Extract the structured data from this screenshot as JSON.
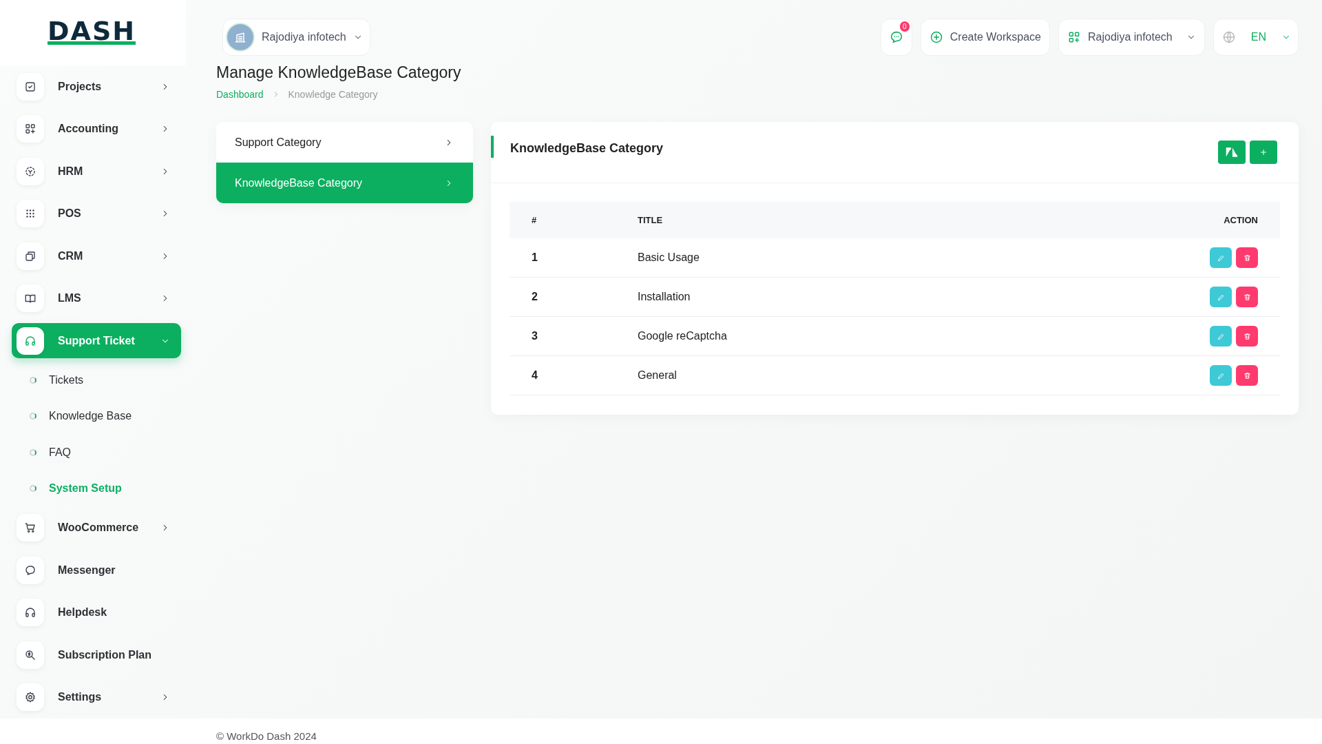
{
  "logo": "DASH",
  "sidebar": {
    "items": [
      {
        "label": "Projects",
        "has_submenu": true,
        "expanded": false,
        "selected": false
      },
      {
        "label": "Accounting",
        "has_submenu": true,
        "expanded": false,
        "selected": false
      },
      {
        "label": "HRM",
        "has_submenu": true,
        "expanded": false,
        "selected": false
      },
      {
        "label": "POS",
        "has_submenu": true,
        "expanded": false,
        "selected": false
      },
      {
        "label": "CRM",
        "has_submenu": true,
        "expanded": false,
        "selected": false
      },
      {
        "label": "LMS",
        "has_submenu": true,
        "expanded": false,
        "selected": false
      },
      {
        "label": "Support Ticket",
        "has_submenu": true,
        "expanded": true,
        "selected": true,
        "children": [
          {
            "label": "Tickets",
            "selected": false
          },
          {
            "label": "Knowledge Base",
            "selected": false
          },
          {
            "label": "FAQ",
            "selected": false
          },
          {
            "label": "System Setup",
            "selected": true
          }
        ]
      },
      {
        "label": "WooCommerce",
        "has_submenu": true,
        "expanded": false,
        "selected": false
      },
      {
        "label": "Messenger",
        "has_submenu": false,
        "selected": false
      },
      {
        "label": "Helpdesk",
        "has_submenu": false,
        "selected": false
      },
      {
        "label": "Subscription Plan",
        "has_submenu": false,
        "selected": false
      },
      {
        "label": "Settings",
        "has_submenu": true,
        "expanded": false,
        "selected": false
      }
    ]
  },
  "topbar": {
    "workspace": "Rajodiya infotech",
    "notification_count": "0",
    "create_workspace": "Create Workspace",
    "company": "Rajodiya infotech",
    "language": "EN"
  },
  "page": {
    "title": "Manage KnowledgeBase Category",
    "breadcrumb": [
      {
        "label": "Dashboard",
        "current": false
      },
      {
        "label": "Knowledge Category",
        "current": true
      }
    ]
  },
  "settings_menu": [
    {
      "label": "Support Category",
      "selected": false
    },
    {
      "label": "KnowledgeBase Category",
      "selected": true
    }
  ],
  "card": {
    "title": "KnowledgeBase Category",
    "table": {
      "columns": [
        "#",
        "TITLE",
        "ACTION"
      ],
      "rows": [
        {
          "number": "1",
          "title": "Basic Usage"
        },
        {
          "number": "2",
          "title": "Installation"
        },
        {
          "number": "3",
          "title": "Google reCaptcha"
        },
        {
          "number": "4",
          "title": "General"
        }
      ]
    }
  },
  "footer": "© WorkDo Dash 2024"
}
